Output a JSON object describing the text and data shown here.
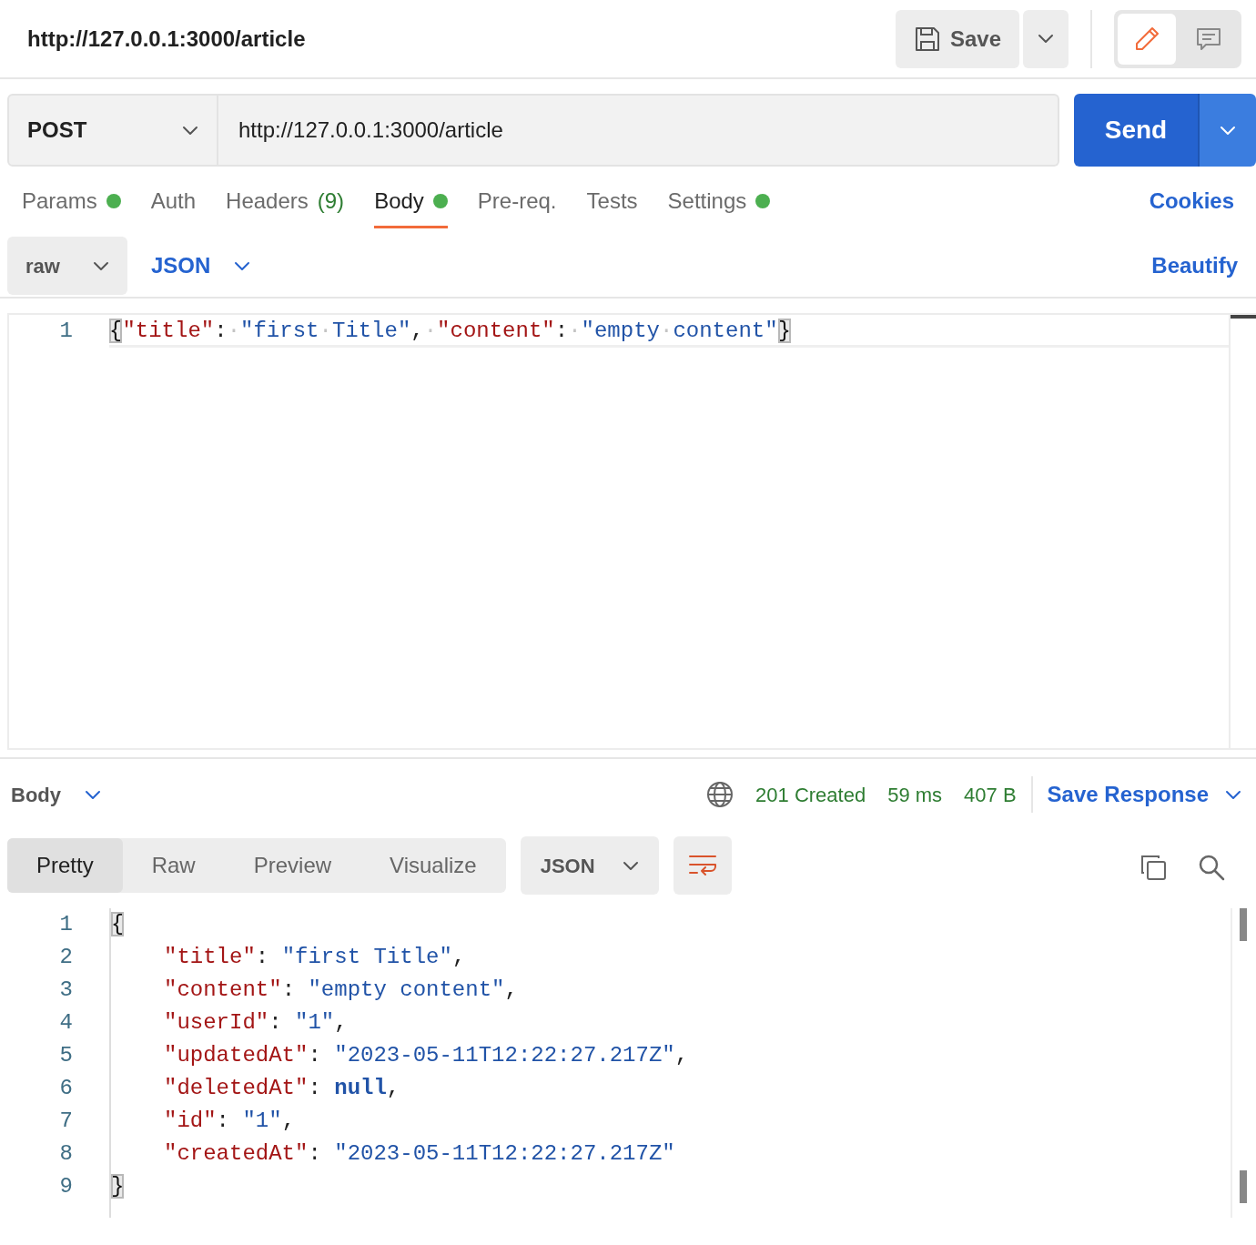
{
  "header": {
    "title": "http://127.0.0.1:3000/article",
    "save_label": "Save",
    "mode_buttons": [
      {
        "kind": "edit",
        "selected": true
      },
      {
        "kind": "comments",
        "selected": false
      }
    ]
  },
  "request": {
    "method": "POST",
    "url": "http://127.0.0.1:3000/article",
    "send_label": "Send"
  },
  "request_tabs": [
    {
      "label": "Params",
      "dot": true,
      "selected": false
    },
    {
      "label": "Auth",
      "dot": false,
      "selected": false
    },
    {
      "label": "Headers",
      "count": "(9)",
      "dot": false,
      "selected": false
    },
    {
      "label": "Body",
      "dot": true,
      "selected": true
    },
    {
      "label": "Pre-req.",
      "dot": false,
      "selected": false
    },
    {
      "label": "Tests",
      "dot": false,
      "selected": false
    },
    {
      "label": "Settings",
      "dot": true,
      "selected": false
    }
  ],
  "cookies_link": "Cookies",
  "body_options": {
    "mode": "raw",
    "language": "JSON",
    "beautify": "Beautify"
  },
  "request_body": {
    "lines": [
      {
        "number": "1",
        "tokens": [
          {
            "kind": "bracket",
            "text": "{"
          },
          {
            "kind": "key",
            "text": "\"title\""
          },
          {
            "kind": "punct",
            "text": ":"
          },
          {
            "kind": "space",
            "text": "·"
          },
          {
            "kind": "string",
            "text": "\"first"
          },
          {
            "kind": "space",
            "text": "·"
          },
          {
            "kind": "string",
            "text": "Title\""
          },
          {
            "kind": "punct",
            "text": ","
          },
          {
            "kind": "space",
            "text": "·"
          },
          {
            "kind": "key",
            "text": "\"content\""
          },
          {
            "kind": "punct",
            "text": ":"
          },
          {
            "kind": "space",
            "text": "·"
          },
          {
            "kind": "string",
            "text": "\"empty"
          },
          {
            "kind": "space",
            "text": "·"
          },
          {
            "kind": "string",
            "text": "content\""
          },
          {
            "kind": "bracket",
            "text": "}"
          }
        ]
      }
    ]
  },
  "response_bar": {
    "section": "Body",
    "status": "201 Created",
    "time": "59 ms",
    "size": "407 B",
    "save_response": "Save Response"
  },
  "response_views": [
    {
      "label": "Pretty",
      "selected": true
    },
    {
      "label": "Raw",
      "selected": false
    },
    {
      "label": "Preview",
      "selected": false
    },
    {
      "label": "Visualize",
      "selected": false
    }
  ],
  "response_format": "JSON",
  "response_body": {
    "lines": [
      {
        "number": "1",
        "tokens": [
          {
            "kind": "bracket",
            "text": "{"
          }
        ],
        "children": [
          {
            "number": "2",
            "tokens": [
              {
                "kind": "key",
                "text": "\"title\""
              },
              {
                "kind": "punct",
                "text": ": "
              },
              {
                "kind": "string",
                "text": "\"first Title\""
              },
              {
                "kind": "punct",
                "text": ","
              }
            ]
          },
          {
            "number": "3",
            "tokens": [
              {
                "kind": "key",
                "text": "\"content\""
              },
              {
                "kind": "punct",
                "text": ": "
              },
              {
                "kind": "string",
                "text": "\"empty content\""
              },
              {
                "kind": "punct",
                "text": ","
              }
            ]
          },
          {
            "number": "4",
            "tokens": [
              {
                "kind": "key",
                "text": "\"userId\""
              },
              {
                "kind": "punct",
                "text": ": "
              },
              {
                "kind": "string",
                "text": "\"1\""
              },
              {
                "kind": "punct",
                "text": ","
              }
            ]
          },
          {
            "number": "5",
            "tokens": [
              {
                "kind": "key",
                "text": "\"updatedAt\""
              },
              {
                "kind": "punct",
                "text": ": "
              },
              {
                "kind": "string",
                "text": "\"2023-05-11T12:22:27.217Z\""
              },
              {
                "kind": "punct",
                "text": ","
              }
            ]
          },
          {
            "number": "6",
            "tokens": [
              {
                "kind": "key",
                "text": "\"deletedAt\""
              },
              {
                "kind": "punct",
                "text": ": "
              },
              {
                "kind": "keyword",
                "text": "null"
              },
              {
                "kind": "punct",
                "text": ","
              }
            ]
          },
          {
            "number": "7",
            "tokens": [
              {
                "kind": "key",
                "text": "\"id\""
              },
              {
                "kind": "punct",
                "text": ": "
              },
              {
                "kind": "string",
                "text": "\"1\""
              },
              {
                "kind": "punct",
                "text": ","
              }
            ]
          },
          {
            "number": "8",
            "tokens": [
              {
                "kind": "key",
                "text": "\"createdAt\""
              },
              {
                "kind": "punct",
                "text": ": "
              },
              {
                "kind": "string",
                "text": "\"2023-05-11T12:22:27.217Z\""
              }
            ]
          }
        ]
      },
      {
        "number": "9",
        "tokens": [
          {
            "kind": "bracket",
            "text": "}"
          }
        ]
      }
    ]
  }
}
